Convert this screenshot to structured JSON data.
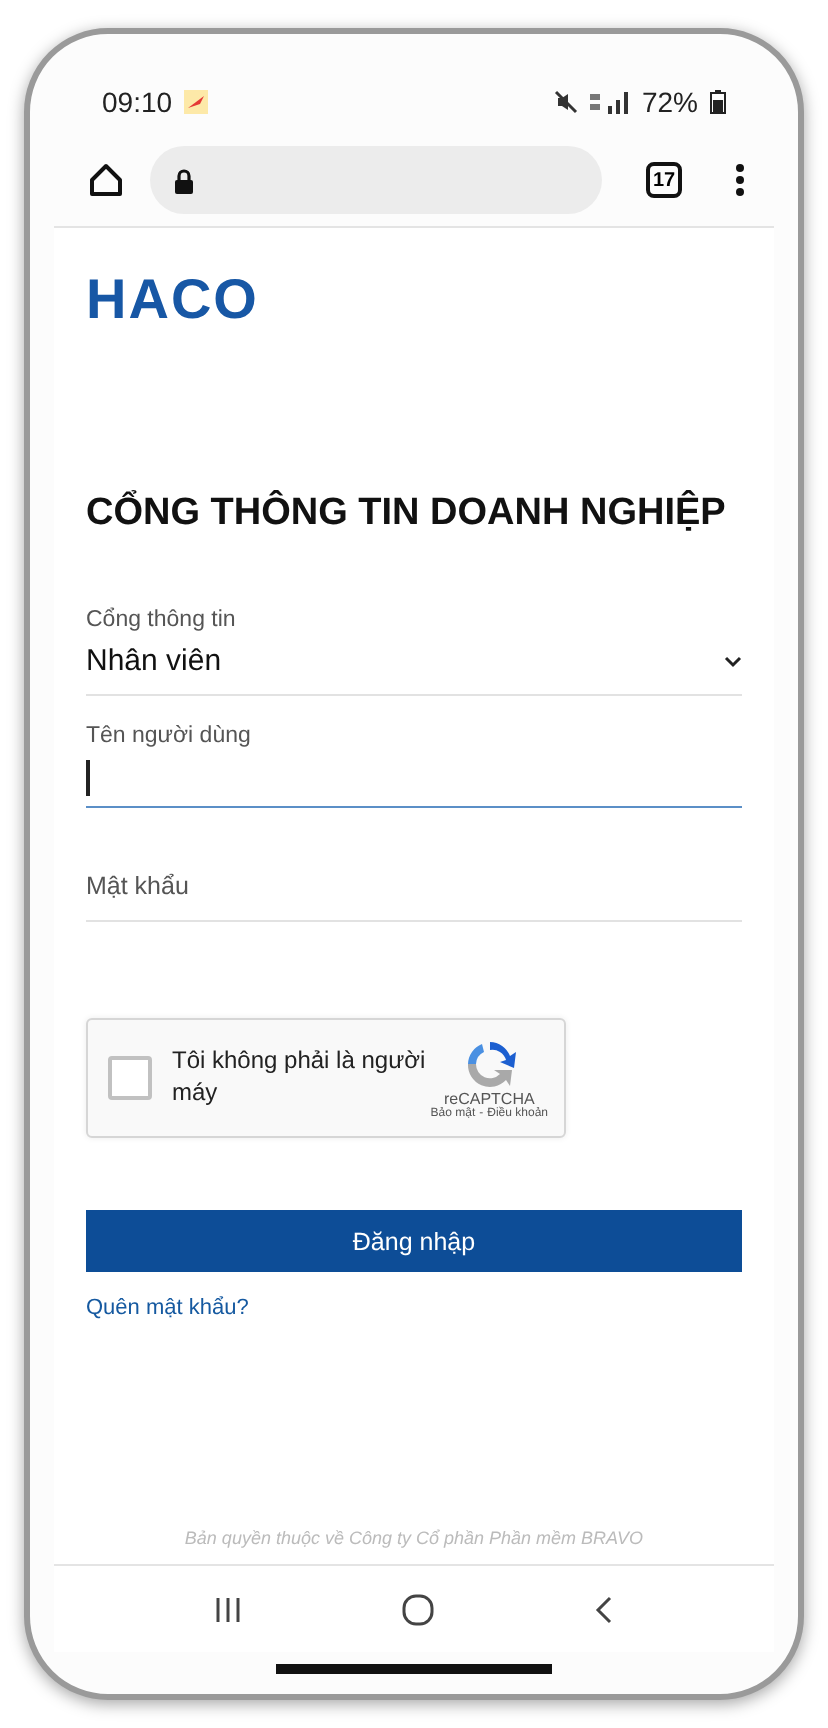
{
  "status_bar": {
    "time": "09:10",
    "battery": "72%"
  },
  "browser": {
    "tab_count": "17"
  },
  "logo": "HACO",
  "title": "CỔNG THÔNG TIN DOANH NGHIỆP",
  "portal": {
    "label": "Cổng thông tin",
    "value": "Nhân viên"
  },
  "username": {
    "label": "Tên người dùng",
    "focused": true
  },
  "password": {
    "placeholder": "Mật khẩu"
  },
  "captcha": {
    "checked": false,
    "label": "Tôi không phải là người máy",
    "brand": "reCAPTCHA",
    "privacy": "Bảo mật",
    "separator": "-",
    "terms": "Điều khoản"
  },
  "login_button": "Đăng nhập",
  "forgot_link": "Quên mật khẩu?",
  "footer": "Bản quyền thuộc về Công ty Cổ phần Phần mềm BRAVO"
}
